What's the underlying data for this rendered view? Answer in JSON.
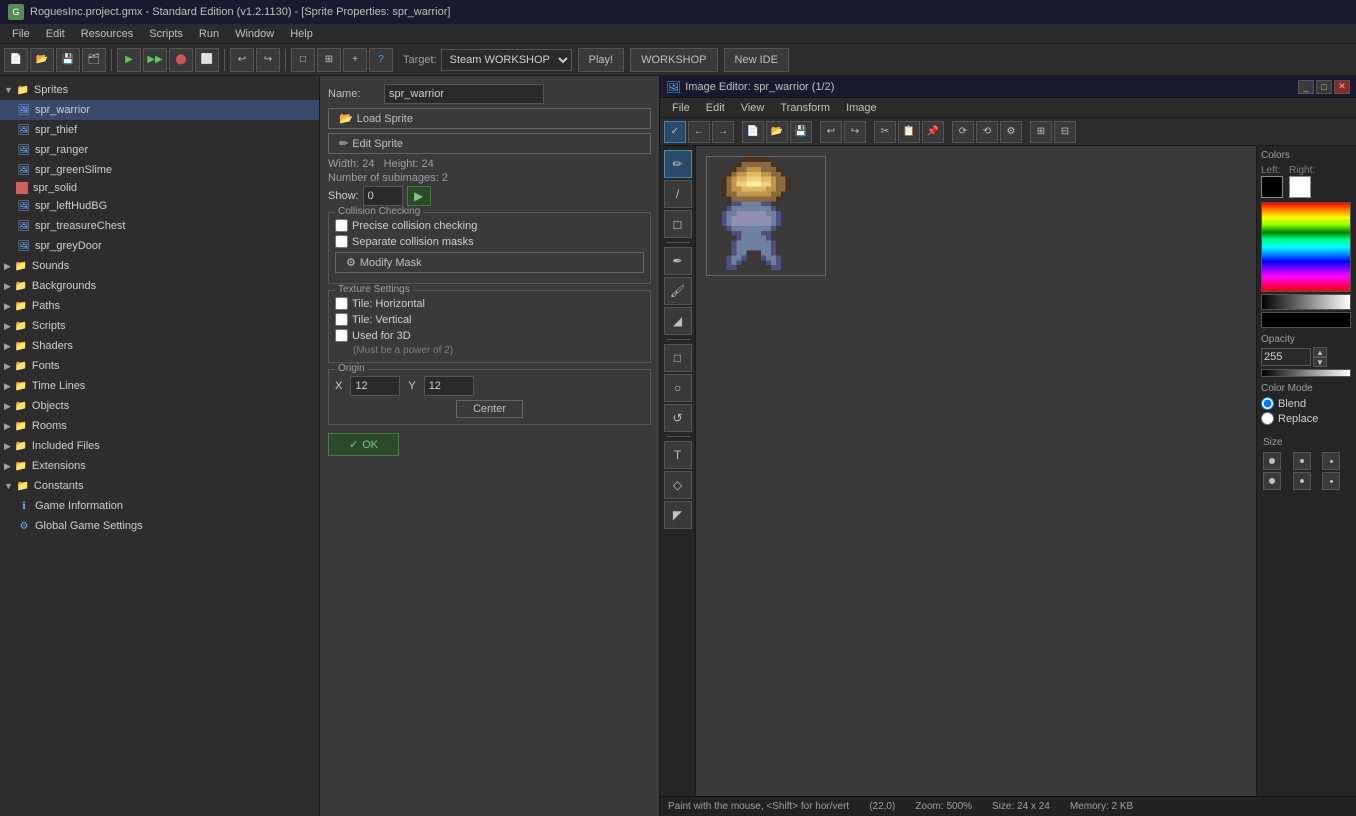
{
  "titlebar": {
    "title": "RoguesInc.project.gmx  -  Standard Edition (v1.2.1130) - [Sprite Properties: spr_warrior]",
    "icon": "G"
  },
  "menubar": {
    "items": [
      "File",
      "Edit",
      "Resources",
      "Scripts",
      "Run",
      "Window",
      "Help"
    ]
  },
  "toolbar": {
    "target_label": "Target:",
    "target_value": "Steam WORKSHOP",
    "play_label": "Play!",
    "workshop_label": "WORKSHOP",
    "newide_label": "New IDE"
  },
  "tree": {
    "items": [
      {
        "label": "Sprites",
        "type": "folder",
        "indent": 0,
        "expanded": true
      },
      {
        "label": "spr_warrior",
        "type": "sprite",
        "indent": 1,
        "selected": true
      },
      {
        "label": "spr_thief",
        "type": "sprite",
        "indent": 1,
        "selected": false
      },
      {
        "label": "spr_ranger",
        "type": "sprite",
        "indent": 1,
        "selected": false
      },
      {
        "label": "spr_greenSlime",
        "type": "sprite",
        "indent": 1,
        "selected": false
      },
      {
        "label": "spr_solid",
        "type": "sprite",
        "indent": 1,
        "selected": false
      },
      {
        "label": "spr_leftHudBG",
        "type": "sprite",
        "indent": 1,
        "selected": false
      },
      {
        "label": "spr_treasureChest",
        "type": "sprite",
        "indent": 1,
        "selected": false
      },
      {
        "label": "spr_greyDoor",
        "type": "sprite",
        "indent": 1,
        "selected": false
      },
      {
        "label": "Sounds",
        "type": "folder",
        "indent": 0,
        "expanded": false
      },
      {
        "label": "Backgrounds",
        "type": "folder",
        "indent": 0,
        "expanded": false
      },
      {
        "label": "Paths",
        "type": "folder",
        "indent": 0,
        "expanded": false
      },
      {
        "label": "Scripts",
        "type": "folder",
        "indent": 0,
        "expanded": false
      },
      {
        "label": "Shaders",
        "type": "folder",
        "indent": 0,
        "expanded": false
      },
      {
        "label": "Fonts",
        "type": "folder",
        "indent": 0,
        "expanded": false
      },
      {
        "label": "Time Lines",
        "type": "folder",
        "indent": 0,
        "expanded": false
      },
      {
        "label": "Objects",
        "type": "folder",
        "indent": 0,
        "expanded": false
      },
      {
        "label": "Rooms",
        "type": "folder",
        "indent": 0,
        "expanded": false
      },
      {
        "label": "Included Files",
        "type": "folder",
        "indent": 0,
        "expanded": false
      },
      {
        "label": "Extensions",
        "type": "folder",
        "indent": 0,
        "expanded": false
      },
      {
        "label": "Constants",
        "type": "folder",
        "indent": 0,
        "expanded": true
      },
      {
        "label": "Game Information",
        "type": "info",
        "indent": 1,
        "selected": false
      },
      {
        "label": "Global Game Settings",
        "type": "settings",
        "indent": 1,
        "selected": false
      }
    ]
  },
  "sprite_props": {
    "name_label": "Name:",
    "name_value": "spr_warrior",
    "load_sprite_label": "Load Sprite",
    "edit_sprite_label": "Edit Sprite",
    "width_label": "Width:",
    "width_value": "24",
    "height_label": "Height:",
    "height_value": "24",
    "subimages_label": "Number of subimages: 2",
    "show_label": "Show:",
    "show_value": "0",
    "collision_title": "Collision Checking",
    "precise_label": "Precise collision checking",
    "separate_label": "Separate collision masks",
    "modify_mask_label": "Modify Mask",
    "texture_title": "Texture Settings",
    "tile_h_label": "Tile: Horizontal",
    "tile_v_label": "Tile: Vertical",
    "used3d_label": "Used for 3D",
    "power2_label": "(Must be a power of 2)",
    "origin_title": "Origin",
    "x_label": "X",
    "x_value": "12",
    "y_label": "Y",
    "y_value": "12",
    "center_label": "Center",
    "ok_label": "✓ OK"
  },
  "image_editor": {
    "title": "Image Editor: spr_warrior (1/2)",
    "menu": [
      "File",
      "Edit",
      "View",
      "Transform",
      "Image"
    ],
    "status": {
      "paint_hint": "Paint with the mouse, <Shift> for hor/vert",
      "coords": "(22,0)",
      "zoom": "Zoom: 500%",
      "size": "Size: 24 x 24",
      "memory": "Memory: 2 KB"
    },
    "colors": {
      "title": "Colors",
      "left_label": "Left:",
      "right_label": "Right:",
      "opacity_title": "Opacity",
      "opacity_value": "255",
      "colormode_title": "Color Mode",
      "blend_label": "Blend",
      "replace_label": "Replace"
    },
    "size_section": {
      "title": "Size"
    }
  }
}
